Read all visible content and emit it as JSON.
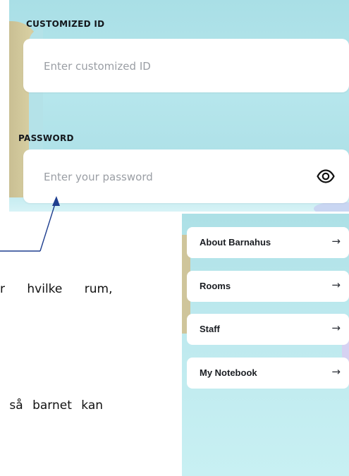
{
  "login": {
    "id_label": "CUSTOMIZED ID",
    "id_placeholder": "Enter customized ID",
    "password_label": "PASSWORD",
    "password_placeholder": "Enter your password",
    "password_toggle_icon": "eye-icon"
  },
  "document": {
    "line1": "r hvilke rum,",
    "line2": " så barnet kan"
  },
  "menu": {
    "items": [
      {
        "label": "About Barnahus",
        "arrow": "→"
      },
      {
        "label": "Rooms",
        "arrow": "→"
      },
      {
        "label": "Staff",
        "arrow": "→"
      },
      {
        "label": "My Notebook",
        "arrow": "→"
      }
    ]
  },
  "colors": {
    "panel_bg": "#a9dfe6",
    "connector": "#1f3f8f",
    "label_text": "#14171c",
    "placeholder": "#9a9ea4"
  }
}
